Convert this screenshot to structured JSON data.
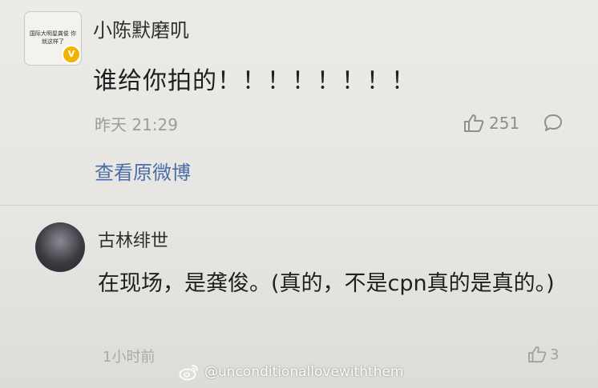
{
  "comment1": {
    "avatar_text": "国际大明星龚俊\n你就这样了",
    "username": "小陈默磨叽",
    "content": "谁给你拍的！！！！！！！！",
    "time": "昨天 21:29",
    "likes": "251",
    "view_original": "查看原微博"
  },
  "comment2": {
    "username": "古林绯世",
    "content": "在现场，是龚俊。(真的，不是cpn真的是真的。)",
    "time": "1小时前",
    "likes": "3"
  },
  "watermark": "@unconditionallovewiththem"
}
